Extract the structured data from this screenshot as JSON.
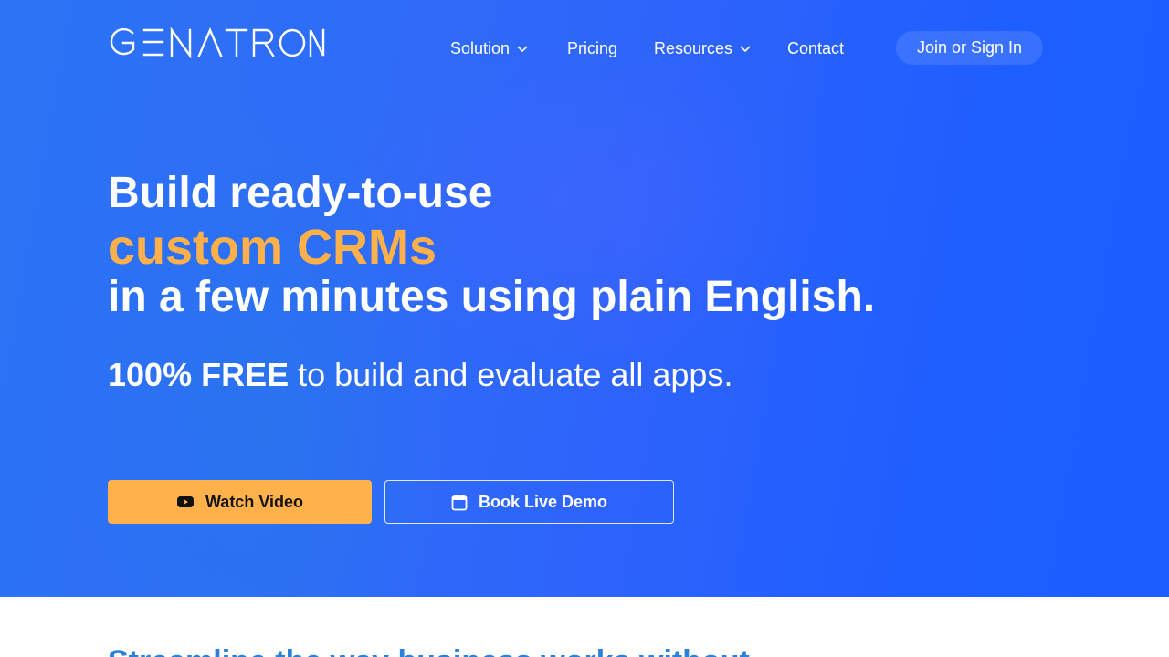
{
  "brand": {
    "name": "GENATRON",
    "accent_color": "#ffb04a",
    "hero_color": "#2563fb"
  },
  "nav": {
    "solution": "Solution",
    "pricing": "Pricing",
    "resources": "Resources",
    "contact": "Contact",
    "signin": "Join or Sign In"
  },
  "hero": {
    "line1": "Build ready-to-use",
    "line2": "custom CRMs",
    "line3": "in a few minutes using plain English.",
    "sub_bold": "100% FREE",
    "sub_rest": " to build and evaluate all apps.",
    "watch_video": "Watch Video",
    "book_demo": "Book Live Demo"
  },
  "icons": {
    "solution_dropdown": "chevron-down-icon",
    "resources_dropdown": "chevron-down-icon",
    "video": "youtube-play-icon",
    "demo": "calendar-icon"
  },
  "below": {
    "partial_heading": "Streamline the way business works without"
  }
}
